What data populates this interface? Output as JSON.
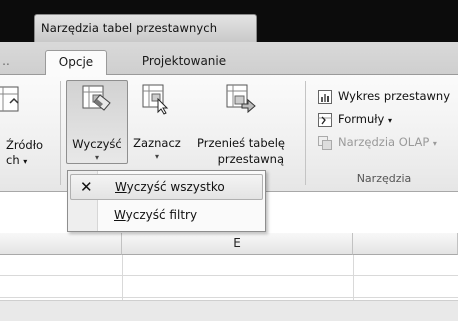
{
  "titlebar": {
    "context_tab": "Narzędzia tabel przestawnych"
  },
  "tabs": {
    "left_stub": "..",
    "opcje": "Opcje",
    "projektowanie": "Projektowanie"
  },
  "ribbon": {
    "source_button": {
      "line1": "Źródło",
      "line2": "ch",
      "icon": "pivot-source-icon"
    },
    "clear_button": {
      "label": "Wyczyść",
      "icon": "eraser-table-icon"
    },
    "select_button": {
      "label": "Zaznacz",
      "icon": "select-table-icon"
    },
    "move_button": {
      "line1": "Przenieś tabelę",
      "line2": "przestawną",
      "icon": "move-table-icon"
    },
    "tools": {
      "chart": "Wykres przestawny",
      "formulas": "Formuły",
      "olap": "Narzędzia OLAP",
      "group_label": "Narzędzia"
    },
    "caret": "▾"
  },
  "menu": {
    "items": [
      {
        "prefix": "W",
        "rest": "yczyść wszystko",
        "icon": "x-close-icon"
      },
      {
        "prefix": "W",
        "rest": "yczyść filtry"
      }
    ]
  },
  "grid": {
    "column_e": "E"
  }
}
